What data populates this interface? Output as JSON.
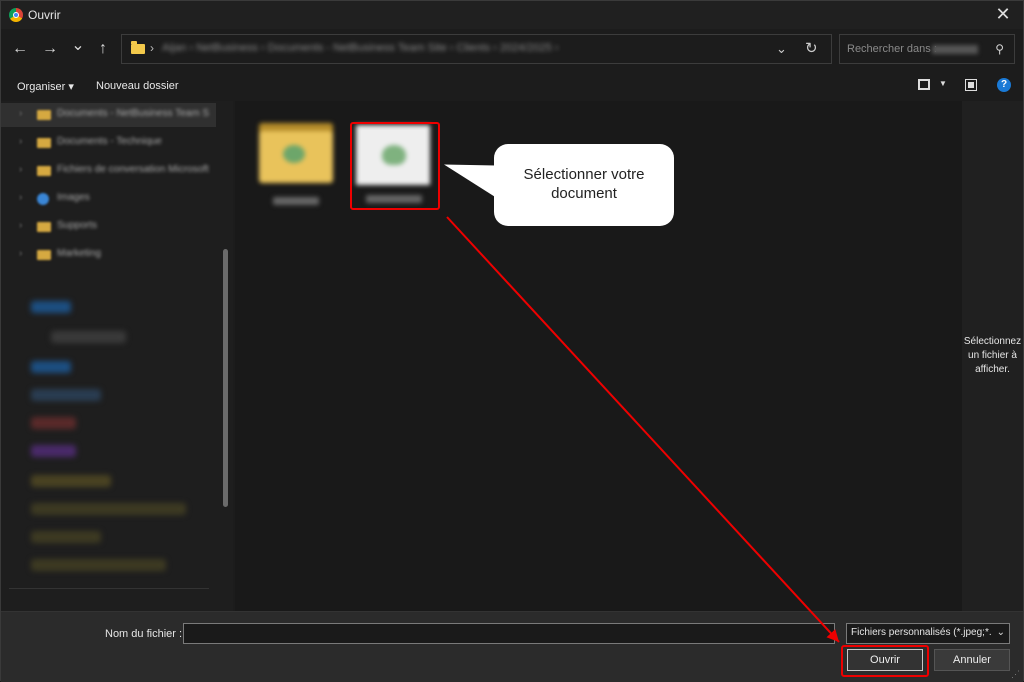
{
  "window": {
    "title": "Ouvrir",
    "close_glyph": "✕"
  },
  "nav": {
    "back_glyph": "←",
    "forward_glyph": "→",
    "recent_glyph": "⌄",
    "up_glyph": "↑",
    "address_sep": "›",
    "address_blurred": "Aijan › NetBusiness › Documents - NetBusiness Team Site › Clients › 2024/2025 ›",
    "address_dropdown_glyph": "⌄",
    "refresh_glyph": "↻"
  },
  "search": {
    "placeholder": "Rechercher dans :",
    "icon_glyph": "⚲"
  },
  "toolbar": {
    "organize_label": "Organiser ▾",
    "new_folder_label": "Nouveau dossier",
    "help_glyph": "?",
    "view_drop_glyph": "▼"
  },
  "sidebar": {
    "items": [
      {
        "label": "Documents - NetBusiness Team S"
      },
      {
        "label": "Documents - Technique"
      },
      {
        "label": "Fichiers de conversation Microsoft"
      },
      {
        "label": "Images"
      },
      {
        "label": "Supports"
      },
      {
        "label": "Marketing"
      }
    ]
  },
  "callout": {
    "line1": "Sélectionner votre",
    "line2": "document"
  },
  "preview": {
    "message": "Sélectionnez un fichier à afficher."
  },
  "bottom": {
    "filename_label": "Nom du fichier :",
    "filename_value": "",
    "filetype_value": "Fichiers personnalisés (*.jpeg;*.j",
    "filetype_chevron": "⌄",
    "open_label": "Ouvrir",
    "cancel_label": "Annuler",
    "grip_glyph": "⋰"
  },
  "colors": {
    "highlight": "#e00000",
    "accent_blue": "#1a7ad6",
    "folder": "#f3c94b",
    "background": "#191919"
  },
  "icons": [
    "chrome-icon",
    "close-icon",
    "back-arrow-icon",
    "forward-arrow-icon",
    "chevron-down-icon",
    "up-arrow-icon",
    "folder-icon",
    "refresh-icon",
    "search-icon",
    "view-icon",
    "preview-pane-icon",
    "help-icon"
  ]
}
